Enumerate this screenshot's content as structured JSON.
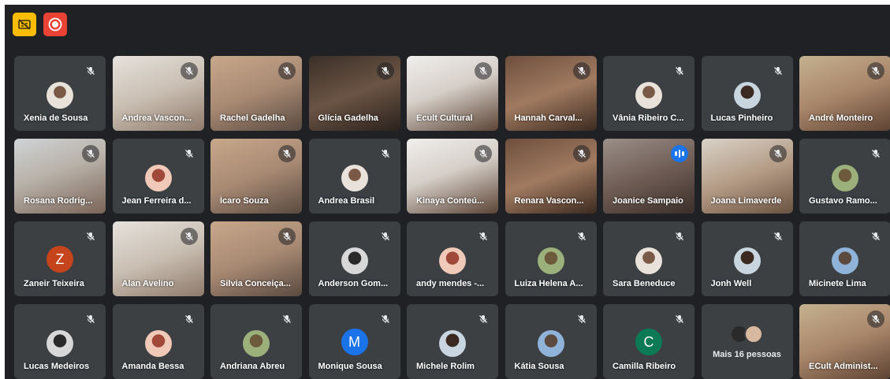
{
  "toolbar": {
    "icons": [
      "captions-off-icon",
      "record-icon"
    ],
    "colors": {
      "captions": "#fbbc04",
      "record": "#ea4335"
    }
  },
  "colors": {
    "background": "#202124",
    "tile": "#3c4043",
    "speaking_outline": "#8ab4f8",
    "speaking_badge": "#1a73e8",
    "letter_avatars": {
      "Z": "#c5441c",
      "M": "#1a73e8",
      "C": "#0b7a55"
    }
  },
  "participants": [
    {
      "name": "Xenia de Sousa",
      "kind": "avatar",
      "muted": true
    },
    {
      "name": "Andrea Vascon...",
      "kind": "video",
      "muted": true
    },
    {
      "name": "Rachel Gadelha",
      "kind": "video",
      "muted": true
    },
    {
      "name": "Glícia Gadelha",
      "kind": "video",
      "muted": true
    },
    {
      "name": "Ecult Cultural",
      "kind": "video",
      "muted": true
    },
    {
      "name": "Hannah Carval...",
      "kind": "video",
      "muted": true
    },
    {
      "name": "Vânia Ribeiro C...",
      "kind": "avatar",
      "muted": true
    },
    {
      "name": "Lucas Pinheiro",
      "kind": "avatar",
      "muted": true
    },
    {
      "name": "André Monteiro",
      "kind": "video",
      "muted": true
    },
    {
      "name": "Rosana Rodrig...",
      "kind": "video",
      "muted": true
    },
    {
      "name": "Jean Ferreira d...",
      "kind": "avatar",
      "muted": true
    },
    {
      "name": "Ícaro Souza",
      "kind": "video",
      "muted": true
    },
    {
      "name": "Andrea Brasil",
      "kind": "avatar",
      "muted": true
    },
    {
      "name": "Kinaya Conteú...",
      "kind": "video",
      "muted": true
    },
    {
      "name": "Renara Vascon...",
      "kind": "video",
      "muted": true
    },
    {
      "name": "Joanice Sampaio",
      "kind": "video",
      "muted": false,
      "speaking": true
    },
    {
      "name": "Joana Limaverde",
      "kind": "video",
      "muted": true
    },
    {
      "name": "Gustavo Ramo...",
      "kind": "avatar",
      "muted": true
    },
    {
      "name": "Zaneir Teixeira",
      "kind": "letter",
      "letter": "Z",
      "muted": true
    },
    {
      "name": "Alan Avelino",
      "kind": "video",
      "muted": true
    },
    {
      "name": "Silvia Conceiça...",
      "kind": "video",
      "muted": true
    },
    {
      "name": "Anderson Gom...",
      "kind": "avatar",
      "muted": true
    },
    {
      "name": "andy mendes -...",
      "kind": "avatar",
      "muted": true
    },
    {
      "name": "Luiza Helena A...",
      "kind": "avatar",
      "muted": true
    },
    {
      "name": "Sara Beneduce",
      "kind": "avatar",
      "muted": true
    },
    {
      "name": "Jonh Well",
      "kind": "avatar",
      "muted": true
    },
    {
      "name": "Micinete Lima",
      "kind": "avatar",
      "muted": true
    },
    {
      "name": "Lucas Medeiros",
      "kind": "avatar",
      "muted": true
    },
    {
      "name": "Amanda Bessa",
      "kind": "avatar",
      "muted": true
    },
    {
      "name": "Andriana Abreu",
      "kind": "avatar",
      "muted": true
    },
    {
      "name": "Monique Sousa",
      "kind": "letter",
      "letter": "M",
      "muted": true
    },
    {
      "name": "Michele Rolim",
      "kind": "avatar",
      "muted": true
    },
    {
      "name": "Kátia Sousa",
      "kind": "avatar",
      "muted": true
    },
    {
      "name": "Camilla Ribeiro",
      "kind": "letter",
      "letter": "C",
      "muted": true
    },
    {
      "name": "",
      "kind": "more",
      "label": "Mais 16 pessoas"
    },
    {
      "name": "ECult Administ...",
      "kind": "video",
      "muted": true
    }
  ]
}
